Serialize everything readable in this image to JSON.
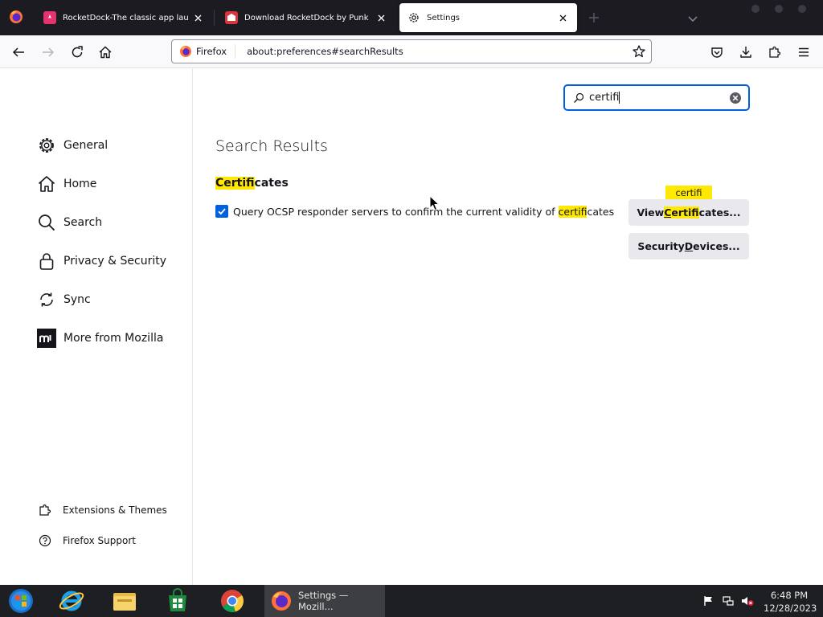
{
  "tabs": [
    {
      "title": "RocketDock-The classic app launch",
      "icon": "rocketdock-favicon",
      "active": false
    },
    {
      "title": "Download RocketDock by Punk Labs",
      "icon": "punklabs-favicon",
      "active": false
    },
    {
      "title": "Settings",
      "icon": "gear-icon",
      "active": true
    }
  ],
  "urlbar": {
    "identity_label": "Firefox",
    "url": "about:preferences#searchResults"
  },
  "sidebar": {
    "categories": [
      {
        "label": "General",
        "icon": "gear-icon"
      },
      {
        "label": "Home",
        "icon": "home-icon"
      },
      {
        "label": "Search",
        "icon": "search-icon"
      },
      {
        "label": "Privacy & Security",
        "icon": "lock-icon"
      },
      {
        "label": "Sync",
        "icon": "sync-icon"
      },
      {
        "label": "More from Mozilla",
        "icon": "mozilla-icon"
      }
    ],
    "footer": [
      {
        "label": "Extensions & Themes",
        "icon": "puzzle-icon"
      },
      {
        "label": "Firefox Support",
        "icon": "help-icon"
      }
    ]
  },
  "search": {
    "value": "certifi"
  },
  "results": {
    "title": "Search Results",
    "section_heading": {
      "highlight": "Certifi",
      "rest": "cates"
    },
    "ocsp": {
      "checked": true,
      "before": "Query OCSP responder servers to confirm the current validity of ",
      "highlight": "certifi",
      "after": "cates"
    },
    "view_certificates": {
      "pre": "View ",
      "accel": "C",
      "highlight_rest": "ertifi",
      "post": "cates..."
    },
    "security_devices": {
      "pre": "Security ",
      "accel": "D",
      "post": "evices..."
    },
    "tooltip": "certifi"
  },
  "taskbar": {
    "apps": [
      "start-orb-icon",
      "internet-explorer-icon",
      "file-explorer-icon",
      "store-icon",
      "chrome-icon"
    ],
    "active_window": "Settings — Mozill...",
    "time": "6:48 PM",
    "date": "12/28/2023"
  },
  "colors": {
    "accent": "#0061e0",
    "highlight": "#ffe900",
    "tabbar": "#1c1b22",
    "taskbar": "#1e1f22"
  }
}
